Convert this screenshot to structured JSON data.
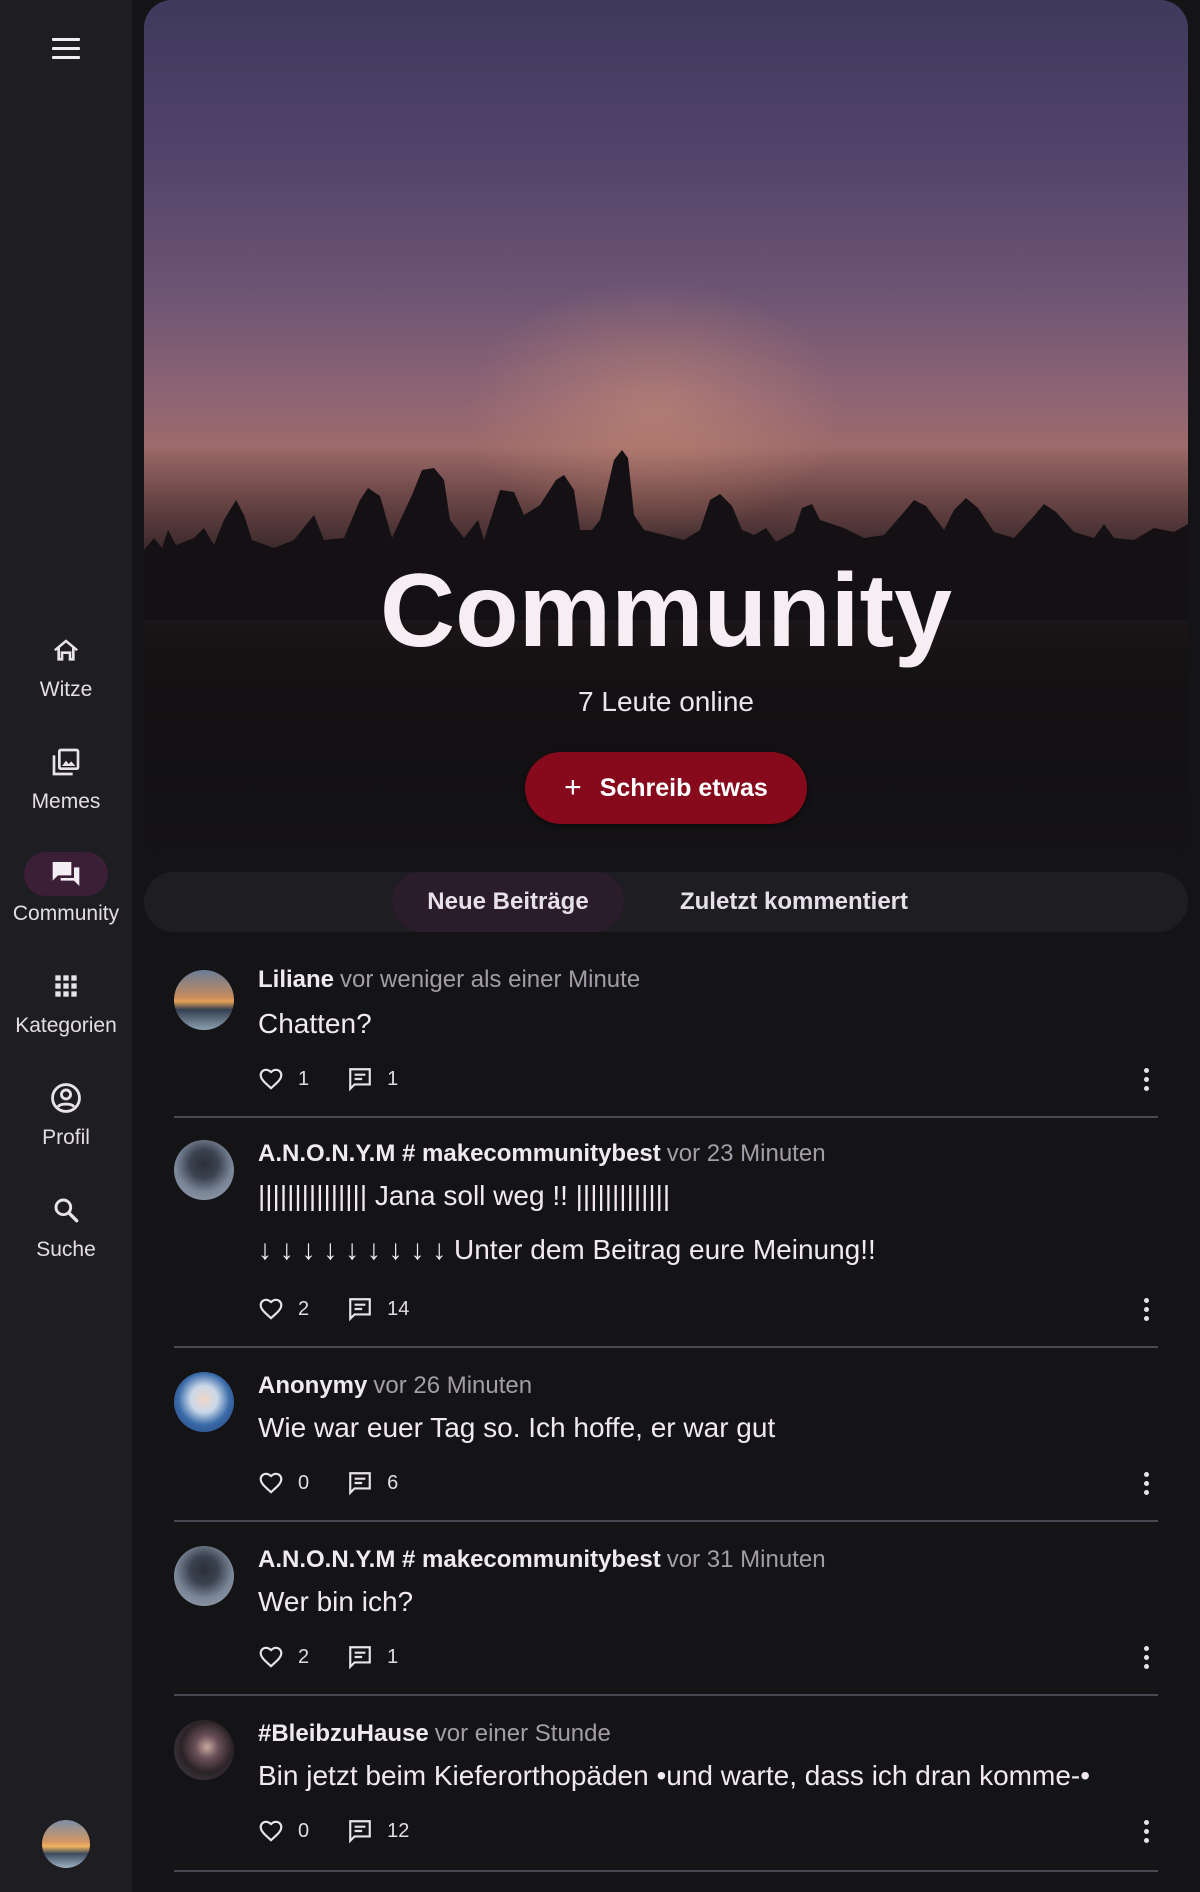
{
  "nav": {
    "items": [
      {
        "label": "Witze",
        "icon": "home-icon"
      },
      {
        "label": "Memes",
        "icon": "image-gallery-icon"
      },
      {
        "label": "Community",
        "icon": "forum-icon",
        "active": true
      },
      {
        "label": "Kategorien",
        "icon": "grid-icon"
      },
      {
        "label": "Profil",
        "icon": "user-circle-icon"
      },
      {
        "label": "Suche",
        "icon": "search-icon"
      }
    ]
  },
  "hero": {
    "title": "Community",
    "online": "7 Leute online",
    "write_button": "Schreib etwas"
  },
  "tabs": [
    {
      "label": "Neue Beiträge",
      "active": true
    },
    {
      "label": "Zuletzt kommentiert",
      "active": false
    }
  ],
  "posts": [
    {
      "author": "Liliane",
      "time": "vor weniger als einer Minute",
      "lines": [
        "Chatten?"
      ],
      "likes": "1",
      "comments": "1"
    },
    {
      "author": "A.N.O.N.Y.M # makecommunitybest",
      "time": "vor 23 Minuten",
      "lines": [
        "||||||||||||||| Jana soll weg !! |||||||||||||",
        "↓ ↓ ↓ ↓ ↓ ↓ ↓ ↓ ↓ Unter dem Beitrag eure Meinung!!"
      ],
      "likes": "2",
      "comments": "14"
    },
    {
      "author": "Anonymy",
      "time": "vor 26 Minuten",
      "lines": [
        "Wie war euer Tag so. Ich hoffe, er war gut"
      ],
      "likes": "0",
      "comments": "6"
    },
    {
      "author": "A.N.O.N.Y.M # makecommunitybest",
      "time": "vor 31 Minuten",
      "lines": [
        "Wer bin ich?"
      ],
      "likes": "2",
      "comments": "1"
    },
    {
      "author": "#BleibzuHause",
      "time": "vor einer Stunde",
      "lines": [
        "Bin jetzt beim Kieferorthopäden •und warte, dass ich dran komme-•"
      ],
      "likes": "0",
      "comments": "12"
    }
  ],
  "colors": {
    "accent": "#860a1c",
    "active_nav": "#3a1f37",
    "background": "#141316",
    "sidebar": "#1e1d21"
  }
}
